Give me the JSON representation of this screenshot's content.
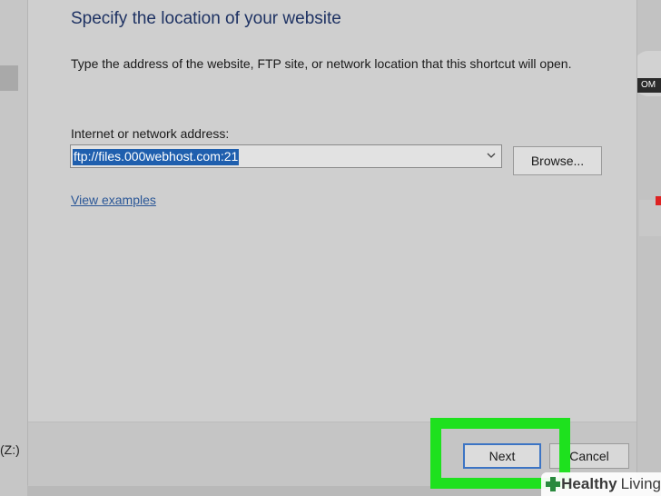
{
  "dialog": {
    "title": "Specify the location of your website",
    "description": "Type the address of the website, FTP site, or network location that this shortcut will open.",
    "address_label": "Internet or network address:",
    "address_value": "ftp://files.000webhost.com:21",
    "browse_label": "Browse...",
    "view_examples_label": "View examples",
    "next_label": "Next",
    "cancel_label": "Cancel"
  },
  "background": {
    "left_drive_label": "(Z:)",
    "right_badge_text": "OM"
  },
  "watermark": {
    "brand_bold": "Healthy",
    "brand_light": "Living"
  },
  "icons": {
    "dropdown": "chevron-down-icon",
    "watermark": "plus-cross-icon"
  },
  "colors": {
    "highlight": "#1ee11e",
    "selection": "#1f5fae",
    "link": "#2b5797",
    "title": "#1e3263"
  }
}
